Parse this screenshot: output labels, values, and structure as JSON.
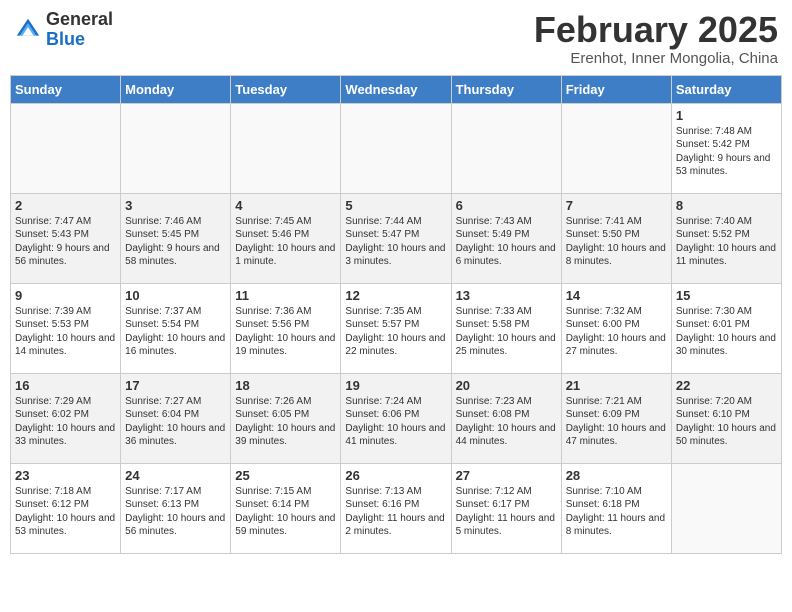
{
  "header": {
    "logo_general": "General",
    "logo_blue": "Blue",
    "month_title": "February 2025",
    "subtitle": "Erenhot, Inner Mongolia, China"
  },
  "days_of_week": [
    "Sunday",
    "Monday",
    "Tuesday",
    "Wednesday",
    "Thursday",
    "Friday",
    "Saturday"
  ],
  "weeks": [
    [
      {
        "day": "",
        "info": ""
      },
      {
        "day": "",
        "info": ""
      },
      {
        "day": "",
        "info": ""
      },
      {
        "day": "",
        "info": ""
      },
      {
        "day": "",
        "info": ""
      },
      {
        "day": "",
        "info": ""
      },
      {
        "day": "1",
        "info": "Sunrise: 7:48 AM\nSunset: 5:42 PM\nDaylight: 9 hours and 53 minutes."
      }
    ],
    [
      {
        "day": "2",
        "info": "Sunrise: 7:47 AM\nSunset: 5:43 PM\nDaylight: 9 hours and 56 minutes."
      },
      {
        "day": "3",
        "info": "Sunrise: 7:46 AM\nSunset: 5:45 PM\nDaylight: 9 hours and 58 minutes."
      },
      {
        "day": "4",
        "info": "Sunrise: 7:45 AM\nSunset: 5:46 PM\nDaylight: 10 hours and 1 minute."
      },
      {
        "day": "5",
        "info": "Sunrise: 7:44 AM\nSunset: 5:47 PM\nDaylight: 10 hours and 3 minutes."
      },
      {
        "day": "6",
        "info": "Sunrise: 7:43 AM\nSunset: 5:49 PM\nDaylight: 10 hours and 6 minutes."
      },
      {
        "day": "7",
        "info": "Sunrise: 7:41 AM\nSunset: 5:50 PM\nDaylight: 10 hours and 8 minutes."
      },
      {
        "day": "8",
        "info": "Sunrise: 7:40 AM\nSunset: 5:52 PM\nDaylight: 10 hours and 11 minutes."
      }
    ],
    [
      {
        "day": "9",
        "info": "Sunrise: 7:39 AM\nSunset: 5:53 PM\nDaylight: 10 hours and 14 minutes."
      },
      {
        "day": "10",
        "info": "Sunrise: 7:37 AM\nSunset: 5:54 PM\nDaylight: 10 hours and 16 minutes."
      },
      {
        "day": "11",
        "info": "Sunrise: 7:36 AM\nSunset: 5:56 PM\nDaylight: 10 hours and 19 minutes."
      },
      {
        "day": "12",
        "info": "Sunrise: 7:35 AM\nSunset: 5:57 PM\nDaylight: 10 hours and 22 minutes."
      },
      {
        "day": "13",
        "info": "Sunrise: 7:33 AM\nSunset: 5:58 PM\nDaylight: 10 hours and 25 minutes."
      },
      {
        "day": "14",
        "info": "Sunrise: 7:32 AM\nSunset: 6:00 PM\nDaylight: 10 hours and 27 minutes."
      },
      {
        "day": "15",
        "info": "Sunrise: 7:30 AM\nSunset: 6:01 PM\nDaylight: 10 hours and 30 minutes."
      }
    ],
    [
      {
        "day": "16",
        "info": "Sunrise: 7:29 AM\nSunset: 6:02 PM\nDaylight: 10 hours and 33 minutes."
      },
      {
        "day": "17",
        "info": "Sunrise: 7:27 AM\nSunset: 6:04 PM\nDaylight: 10 hours and 36 minutes."
      },
      {
        "day": "18",
        "info": "Sunrise: 7:26 AM\nSunset: 6:05 PM\nDaylight: 10 hours and 39 minutes."
      },
      {
        "day": "19",
        "info": "Sunrise: 7:24 AM\nSunset: 6:06 PM\nDaylight: 10 hours and 41 minutes."
      },
      {
        "day": "20",
        "info": "Sunrise: 7:23 AM\nSunset: 6:08 PM\nDaylight: 10 hours and 44 minutes."
      },
      {
        "day": "21",
        "info": "Sunrise: 7:21 AM\nSunset: 6:09 PM\nDaylight: 10 hours and 47 minutes."
      },
      {
        "day": "22",
        "info": "Sunrise: 7:20 AM\nSunset: 6:10 PM\nDaylight: 10 hours and 50 minutes."
      }
    ],
    [
      {
        "day": "23",
        "info": "Sunrise: 7:18 AM\nSunset: 6:12 PM\nDaylight: 10 hours and 53 minutes."
      },
      {
        "day": "24",
        "info": "Sunrise: 7:17 AM\nSunset: 6:13 PM\nDaylight: 10 hours and 56 minutes."
      },
      {
        "day": "25",
        "info": "Sunrise: 7:15 AM\nSunset: 6:14 PM\nDaylight: 10 hours and 59 minutes."
      },
      {
        "day": "26",
        "info": "Sunrise: 7:13 AM\nSunset: 6:16 PM\nDaylight: 11 hours and 2 minutes."
      },
      {
        "day": "27",
        "info": "Sunrise: 7:12 AM\nSunset: 6:17 PM\nDaylight: 11 hours and 5 minutes."
      },
      {
        "day": "28",
        "info": "Sunrise: 7:10 AM\nSunset: 6:18 PM\nDaylight: 11 hours and 8 minutes."
      },
      {
        "day": "",
        "info": ""
      }
    ]
  ]
}
